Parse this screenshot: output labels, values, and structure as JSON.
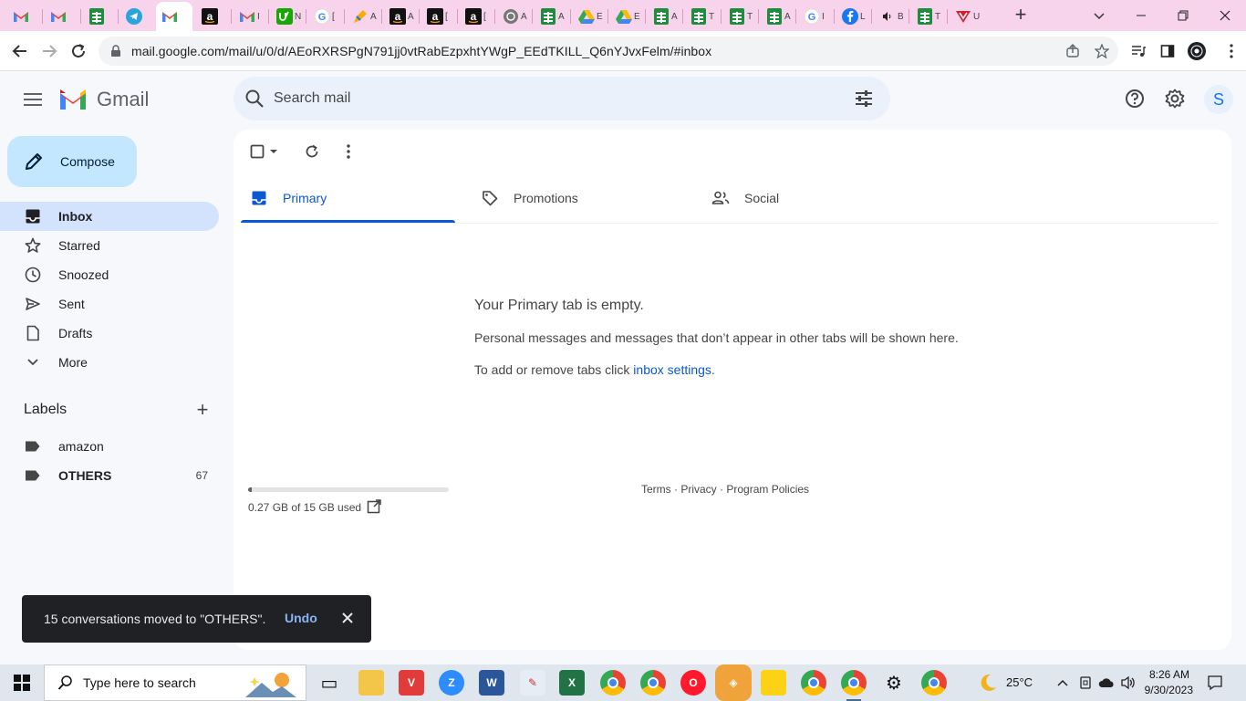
{
  "browser": {
    "tabs": [
      {
        "icon": "gmail-icon",
        "letter": ""
      },
      {
        "icon": "gmail-icon",
        "letter": ""
      },
      {
        "icon": "sheets-icon",
        "letter": ""
      },
      {
        "icon": "telegram-icon",
        "letter": ""
      },
      {
        "icon": "gmail-icon",
        "letter": "",
        "active": true
      },
      {
        "icon": "amazon-icon",
        "letter": ""
      },
      {
        "icon": "gmail-icon",
        "letter": "I"
      },
      {
        "icon": "upwork-icon",
        "letter": "N"
      },
      {
        "icon": "google-icon",
        "letter": "["
      },
      {
        "icon": "pen-icon",
        "letter": "A"
      },
      {
        "icon": "amazon-icon",
        "letter": "A"
      },
      {
        "icon": "amazon-icon",
        "letter": "["
      },
      {
        "icon": "amazon-icon",
        "letter": "["
      },
      {
        "icon": "globe-icon",
        "letter": "A"
      },
      {
        "icon": "sheets-icon",
        "letter": "A"
      },
      {
        "icon": "drive-icon",
        "letter": "E"
      },
      {
        "icon": "drive-icon",
        "letter": "E"
      },
      {
        "icon": "sheets-icon",
        "letter": "A"
      },
      {
        "icon": "sheets-icon",
        "letter": "T"
      },
      {
        "icon": "sheets-icon",
        "letter": "T"
      },
      {
        "icon": "sheets-icon",
        "letter": "A"
      },
      {
        "icon": "google-icon",
        "letter": "I"
      },
      {
        "icon": "facebook-icon",
        "letter": "L"
      },
      {
        "icon": "audio-icon",
        "letter": "B"
      },
      {
        "icon": "sheets-icon",
        "letter": "T"
      },
      {
        "icon": "vivaldi-icon",
        "letter": "U"
      }
    ],
    "url": "mail.google.com/mail/u/0/d/AEoRXRSPgN791jj0vtRabEzpxhtYWgP_EEdTKILL_Q6nYJvxFelm/#inbox"
  },
  "gmail": {
    "brand": "Gmail",
    "search_placeholder": "Search mail",
    "avatar_letter": "S",
    "compose_label": "Compose",
    "nav": [
      {
        "label": "Inbox",
        "icon": "inbox-icon",
        "selected": true
      },
      {
        "label": "Starred",
        "icon": "star-icon"
      },
      {
        "label": "Snoozed",
        "icon": "clock-icon"
      },
      {
        "label": "Sent",
        "icon": "send-icon"
      },
      {
        "label": "Drafts",
        "icon": "draft-icon"
      },
      {
        "label": "More",
        "icon": "chevron-down-icon"
      }
    ],
    "labels_heading": "Labels",
    "labels": [
      {
        "label": "amazon",
        "count": ""
      },
      {
        "label": "OTHERS",
        "count": "67",
        "bold": true
      }
    ],
    "category_tabs": [
      {
        "label": "Primary",
        "icon": "inbox-icon",
        "active": true
      },
      {
        "label": "Promotions",
        "icon": "tag-icon"
      },
      {
        "label": "Social",
        "icon": "people-icon"
      }
    ],
    "empty_state": {
      "title": "Your Primary tab is empty.",
      "description": "Personal messages and messages that don’t appear in other tabs will be shown here.",
      "settings_prefix": "To add or remove tabs click ",
      "settings_link": "inbox settings",
      "settings_suffix": "."
    },
    "storage": {
      "used_text": "0.27 GB of 15 GB used",
      "fraction": 0.018
    },
    "footer": {
      "terms": "Terms",
      "privacy": "Privacy",
      "policies": "Program Policies",
      "separator": " · "
    },
    "snackbar": {
      "message": "15 conversations moved to \"OTHERS\".",
      "undo": "Undo"
    }
  },
  "taskbar": {
    "search_placeholder": "Type here to search",
    "temperature": "25°C",
    "time": "8:26 AM",
    "date": "9/30/2023"
  },
  "colors": {
    "tabstrip": "#f7d3ec",
    "accent": "#0b57d0",
    "compose": "#c2e7ff",
    "selected_nav": "#d3e3fd",
    "snackbar": "#202124"
  }
}
